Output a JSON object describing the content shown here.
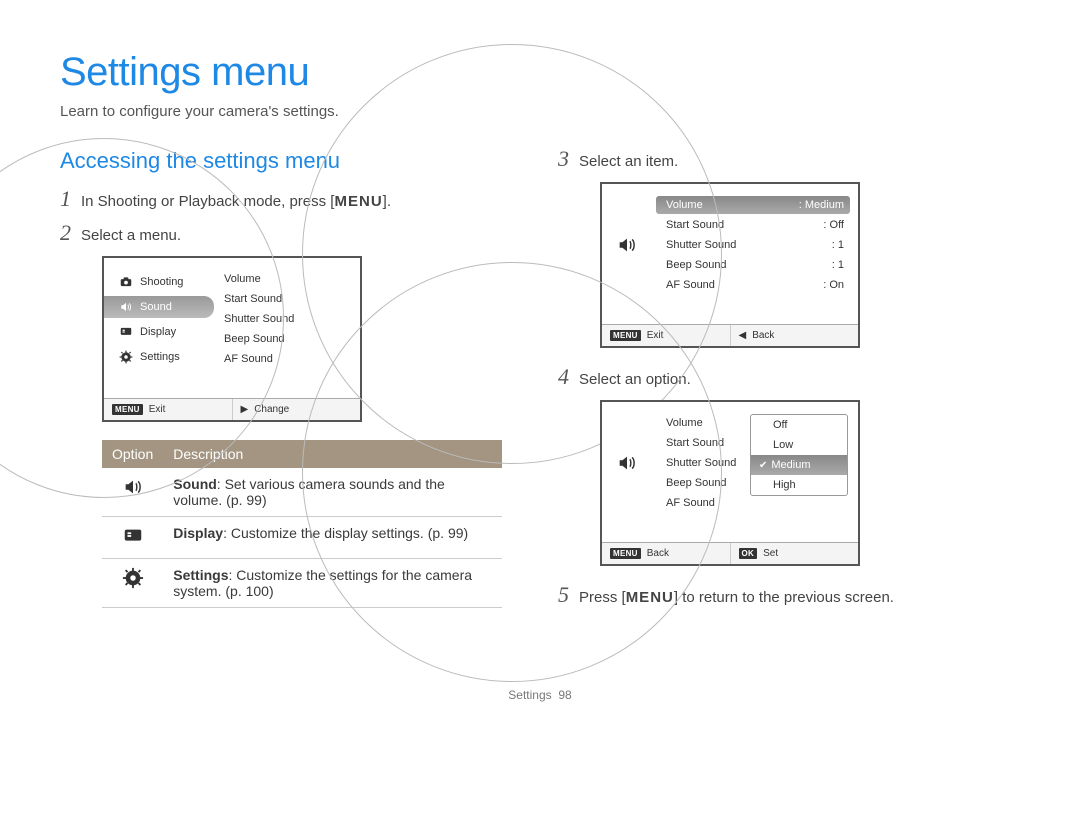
{
  "page": {
    "title": "Settings menu",
    "subtitle": "Learn to configure your camera's settings.",
    "footer_label": "Settings",
    "footer_page": "98"
  },
  "section_heading": "Accessing the settings menu",
  "steps": {
    "s1_pre": "In Shooting or Playback mode, press [",
    "s1_menu": "MENU",
    "s1_post": "].",
    "s2": "Select a menu.",
    "s3": "Select an item.",
    "s4": "Select an option.",
    "s5_pre": "Press [",
    "s5_menu": "MENU",
    "s5_post": "] to return to the previous screen."
  },
  "screen1": {
    "left_items": [
      {
        "icon": "camera",
        "label": "Shooting",
        "active": false
      },
      {
        "icon": "speaker",
        "label": "Sound",
        "active": true
      },
      {
        "icon": "display",
        "label": "Display",
        "active": false
      },
      {
        "icon": "gear",
        "label": "Settings",
        "active": false
      }
    ],
    "right_items": [
      {
        "label": "Volume"
      },
      {
        "label": "Start Sound"
      },
      {
        "label": "Shutter Sound"
      },
      {
        "label": "Beep Sound"
      },
      {
        "label": "AF Sound"
      }
    ],
    "foot_left_badge": "MENU",
    "foot_left": "Exit",
    "foot_right_glyph": "▶",
    "foot_right": "Change"
  },
  "screen2": {
    "left_icon": "speaker",
    "items": [
      {
        "label": "Volume",
        "value": "Medium",
        "highlight": true
      },
      {
        "label": "Start Sound",
        "value": "Off"
      },
      {
        "label": "Shutter Sound",
        "value": "1"
      },
      {
        "label": "Beep Sound",
        "value": "1"
      },
      {
        "label": "AF Sound",
        "value": "On"
      }
    ],
    "foot_left_badge": "MENU",
    "foot_left": "Exit",
    "foot_right_glyph": "◀",
    "foot_right": "Back"
  },
  "screen3": {
    "left_icon": "speaker",
    "items": [
      {
        "label": "Volume"
      },
      {
        "label": "Start Sound"
      },
      {
        "label": "Shutter Sound"
      },
      {
        "label": "Beep Sound"
      },
      {
        "label": "AF Sound"
      }
    ],
    "popup": [
      {
        "label": "Off",
        "selected": false
      },
      {
        "label": "Low",
        "selected": false
      },
      {
        "label": "Medium",
        "selected": true
      },
      {
        "label": "High",
        "selected": false
      }
    ],
    "foot_left_badge": "MENU",
    "foot_left": "Back",
    "foot_right_badge": "OK",
    "foot_right": "Set"
  },
  "opt_table": {
    "head_option": "Option",
    "head_description": "Description",
    "rows": [
      {
        "icon": "speaker",
        "name": "Sound",
        "desc": ": Set various camera sounds and the volume. (p. 99)"
      },
      {
        "icon": "display",
        "name": "Display",
        "desc": ": Customize the display settings. (p. 99)"
      },
      {
        "icon": "gear",
        "name": "Settings",
        "desc": ": Customize the settings for the camera system. (p. 100)"
      }
    ]
  },
  "nums": {
    "n1": "1",
    "n2": "2",
    "n3": "3",
    "n4": "4",
    "n5": "5"
  }
}
